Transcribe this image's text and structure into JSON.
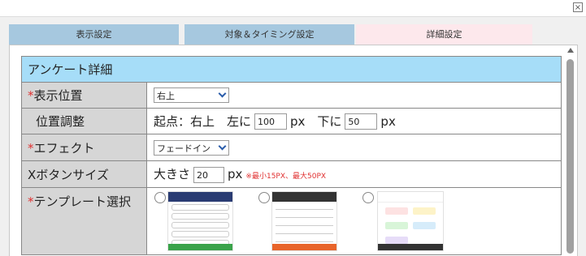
{
  "window": {
    "close_glyph": "×"
  },
  "tabs": [
    {
      "label": "表示設定",
      "active": false
    },
    {
      "label": "対象＆タイミング設定",
      "active": false
    },
    {
      "label": "詳細設定",
      "active": true
    }
  ],
  "section": {
    "title": "アンケート詳細"
  },
  "rows": {
    "position": {
      "required_mark": "*",
      "label": "表示位置",
      "value": "右上"
    },
    "adjust": {
      "label": "位置調整",
      "prefix": "起点：右上　左に",
      "left_value": "100",
      "unit1": "px　下に",
      "down_value": "50",
      "unit2": "px"
    },
    "effect": {
      "required_mark": "*",
      "label": "エフェクト",
      "value": "フェードイン"
    },
    "xsize": {
      "label": "Xボタンサイズ",
      "prefix": "大きさ",
      "value": "20",
      "unit": "px",
      "note": "※最小15PX、最大50PX"
    },
    "template": {
      "required_mark": "*",
      "label": "テンプレート選択"
    }
  },
  "colors": {
    "tab_inactive": "#a6c8df",
    "tab_active": "#fde8ec",
    "section_header": "#a6ddf8",
    "label_bg": "#d6d6d6",
    "required": "#e03030",
    "template1_accent": "#3aa34a",
    "template2_accent": "#e8642a",
    "template3_accent": "#333333"
  },
  "icons": {
    "close": "close-icon",
    "dropdown": "chevron-down-icon",
    "scroll_up": "arrow-up-icon"
  }
}
